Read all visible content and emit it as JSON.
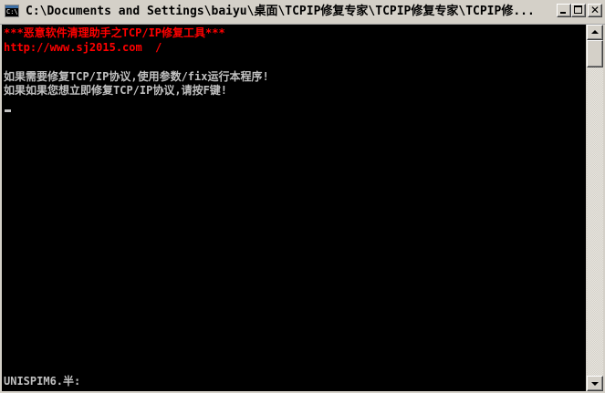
{
  "window": {
    "title": "C:\\Documents and Settings\\baiyu\\桌面\\TCPIP修复专家\\TCPIP修复专家\\TCPIP修...",
    "icon_text": "C:\\",
    "icon": "console-window-icon",
    "controls": {
      "minimize": "minimize-icon",
      "maximize": "maximize-icon",
      "close": "close-icon",
      "close_glyph": "✕"
    }
  },
  "console": {
    "lines": [
      {
        "text": "***恶意软件清理助手之TCP/IP修复工具***",
        "color": "#ff0000"
      },
      {
        "text": "http://www.sj2015.com  /",
        "color": "#ff0000"
      },
      {
        "text": "",
        "color": "#c0c0c0"
      },
      {
        "text": "如果需要修复TCP/IP协议,使用参数/fix运行本程序!",
        "color": "#c0c0c0"
      },
      {
        "text": "如果如果您想立即修复TCP/IP协议,请按F键!",
        "color": "#c0c0c0"
      }
    ],
    "ime_status": "UNISPIM6.半:"
  },
  "colors": {
    "console_bg": "#000000",
    "console_fg": "#c0c0c0",
    "highlight": "#ff0000",
    "chrome": "#d4d0c8"
  }
}
